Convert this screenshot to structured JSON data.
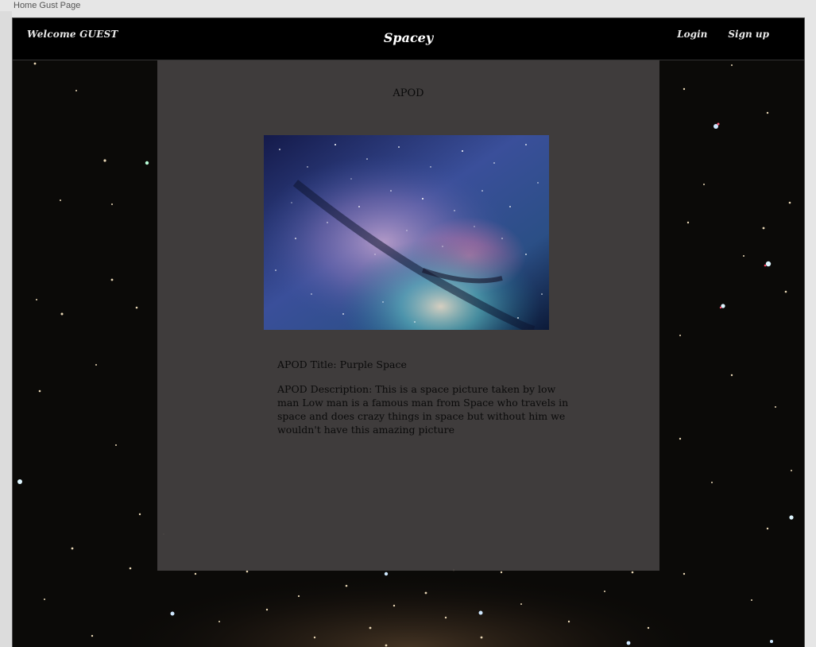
{
  "window": {
    "title": "Home Gust Page"
  },
  "navbar": {
    "welcome": "Welcome GUEST",
    "brand": "Spacey",
    "login_label": "Login",
    "signup_label": "Sign up"
  },
  "apod": {
    "heading": "APOD",
    "image_alt": "Milky Way purple space photo",
    "title_line": "APOD Title: Purple Space",
    "description_line": "APOD Description: This is a space picture taken by low man Low man is a famous man from Space who travels in space and does crazy things in space but without him we wouldn't have this amazing picture"
  },
  "colors": {
    "navbar_bg": "#000000",
    "panel_bg": "#423e3e",
    "page_bg": "#0b0a08"
  }
}
